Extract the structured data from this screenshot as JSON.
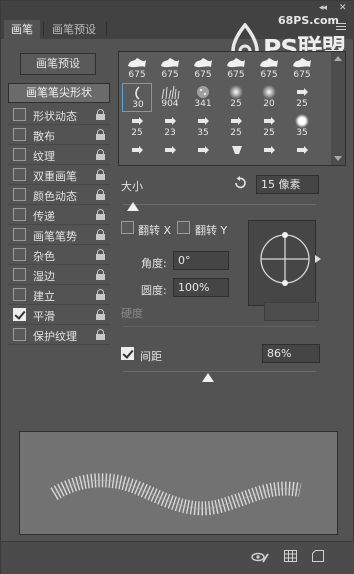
{
  "tabs": [
    {
      "label": "画笔",
      "active": true
    },
    {
      "label": "画笔预设",
      "active": false
    }
  ],
  "window_controls": {
    "collapse": "◂◂",
    "close": "✕"
  },
  "watermark": {
    "url": "68PS.com",
    "text": "PS联盟"
  },
  "left": {
    "preset_button": "画笔预设",
    "tip_header": "画笔笔尖形状",
    "options": [
      {
        "label": "形状动态",
        "checked": false
      },
      {
        "label": "散布",
        "checked": false
      },
      {
        "label": "纹理",
        "checked": false
      },
      {
        "label": "双重画笔",
        "checked": false
      },
      {
        "label": "颜色动态",
        "checked": false
      },
      {
        "label": "传递",
        "checked": false
      },
      {
        "label": "画笔笔势",
        "checked": false
      },
      {
        "label": "杂色",
        "checked": false
      },
      {
        "label": "湿边",
        "checked": false
      },
      {
        "label": "建立",
        "checked": false
      },
      {
        "label": "平滑",
        "checked": true
      },
      {
        "label": "保护纹理",
        "checked": false
      }
    ]
  },
  "brush_grid": {
    "rows": [
      [
        "675",
        "675",
        "675",
        "675",
        "675",
        "675"
      ],
      [
        "30",
        "904",
        "341",
        "25",
        "20",
        "25"
      ],
      [
        "25",
        "23",
        "35",
        "25",
        "25",
        "35"
      ],
      [
        "",
        "",
        "",
        "",
        "",
        ""
      ]
    ],
    "selected": {
      "row": 1,
      "col": 0
    }
  },
  "size": {
    "label": "大小",
    "value": "15 像素",
    "fraction": 0.05
  },
  "flip": {
    "x_label": "翻转 X",
    "y_label": "翻转 Y",
    "x_checked": false,
    "y_checked": false
  },
  "angle": {
    "label": "角度:",
    "value": "0°"
  },
  "roundness": {
    "label": "圆度:",
    "value": "100%"
  },
  "hardness": {
    "label": "硬度",
    "value": ""
  },
  "spacing": {
    "label": "间距",
    "checked": true,
    "value": "86%",
    "fraction": 0.86
  },
  "colors": {
    "panel": "#535353",
    "selection": "#5aa3d6",
    "check": "#ededed"
  },
  "icons": [
    "reset-icon",
    "lock-icon",
    "eye-brush-icon",
    "grid-icon",
    "new-icon",
    "panel-menu-icon",
    "angle-arrow-icon"
  ]
}
